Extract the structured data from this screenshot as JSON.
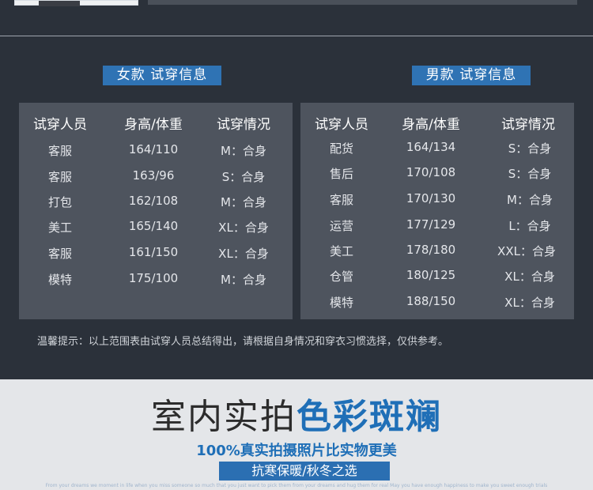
{
  "women": {
    "title": "女款  试穿信息",
    "headers": [
      "试穿人员",
      "身高/体重",
      "试穿情况"
    ],
    "rows": [
      [
        "客服",
        "164/110",
        "M：合身"
      ],
      [
        "客服",
        "163/96",
        "S：合身"
      ],
      [
        "打包",
        "162/108",
        "M：合身"
      ],
      [
        "美工",
        "165/140",
        "XL：合身"
      ],
      [
        "客服",
        "161/150",
        "XL：合身"
      ],
      [
        "模特",
        "175/100",
        "M：合身"
      ]
    ]
  },
  "men": {
    "title": "男款  试穿信息",
    "headers": [
      "试穿人员",
      "身高/体重",
      "试穿情况"
    ],
    "rows": [
      [
        "配货",
        "164/134",
        "S：合身"
      ],
      [
        "售后",
        "170/108",
        "S：合身"
      ],
      [
        "客服",
        "170/130",
        "M：合身"
      ],
      [
        "运营",
        "177/129",
        "L：合身"
      ],
      [
        "美工",
        "178/180",
        "XXL：合身"
      ],
      [
        "仓管",
        "180/125",
        "XL：合身"
      ],
      [
        "模特",
        "188/150",
        "XL：合身"
      ]
    ]
  },
  "tip": "温馨提示：以上范围表由试穿人员总结得出，请根据自身情况和穿衣习惯选择，仅供参考。",
  "banner": {
    "headline_dark": "室内实拍",
    "headline_blue": "色彩斑斓",
    "subline": "100%真实拍摄照片比实物更美",
    "tag": "抗寒保暖/秋冬之选",
    "fine_print": "From your dreams we moment in life when you miss someone so much that you just want to pick them from your dreams and hug them for real May you have enough happiness to make you sweet enough trials"
  },
  "colors": {
    "dark_bg": "#2b313a",
    "table_bg": "#4e545e",
    "accent_blue": "#2f73b4",
    "light_bg": "#e4e6e9"
  }
}
